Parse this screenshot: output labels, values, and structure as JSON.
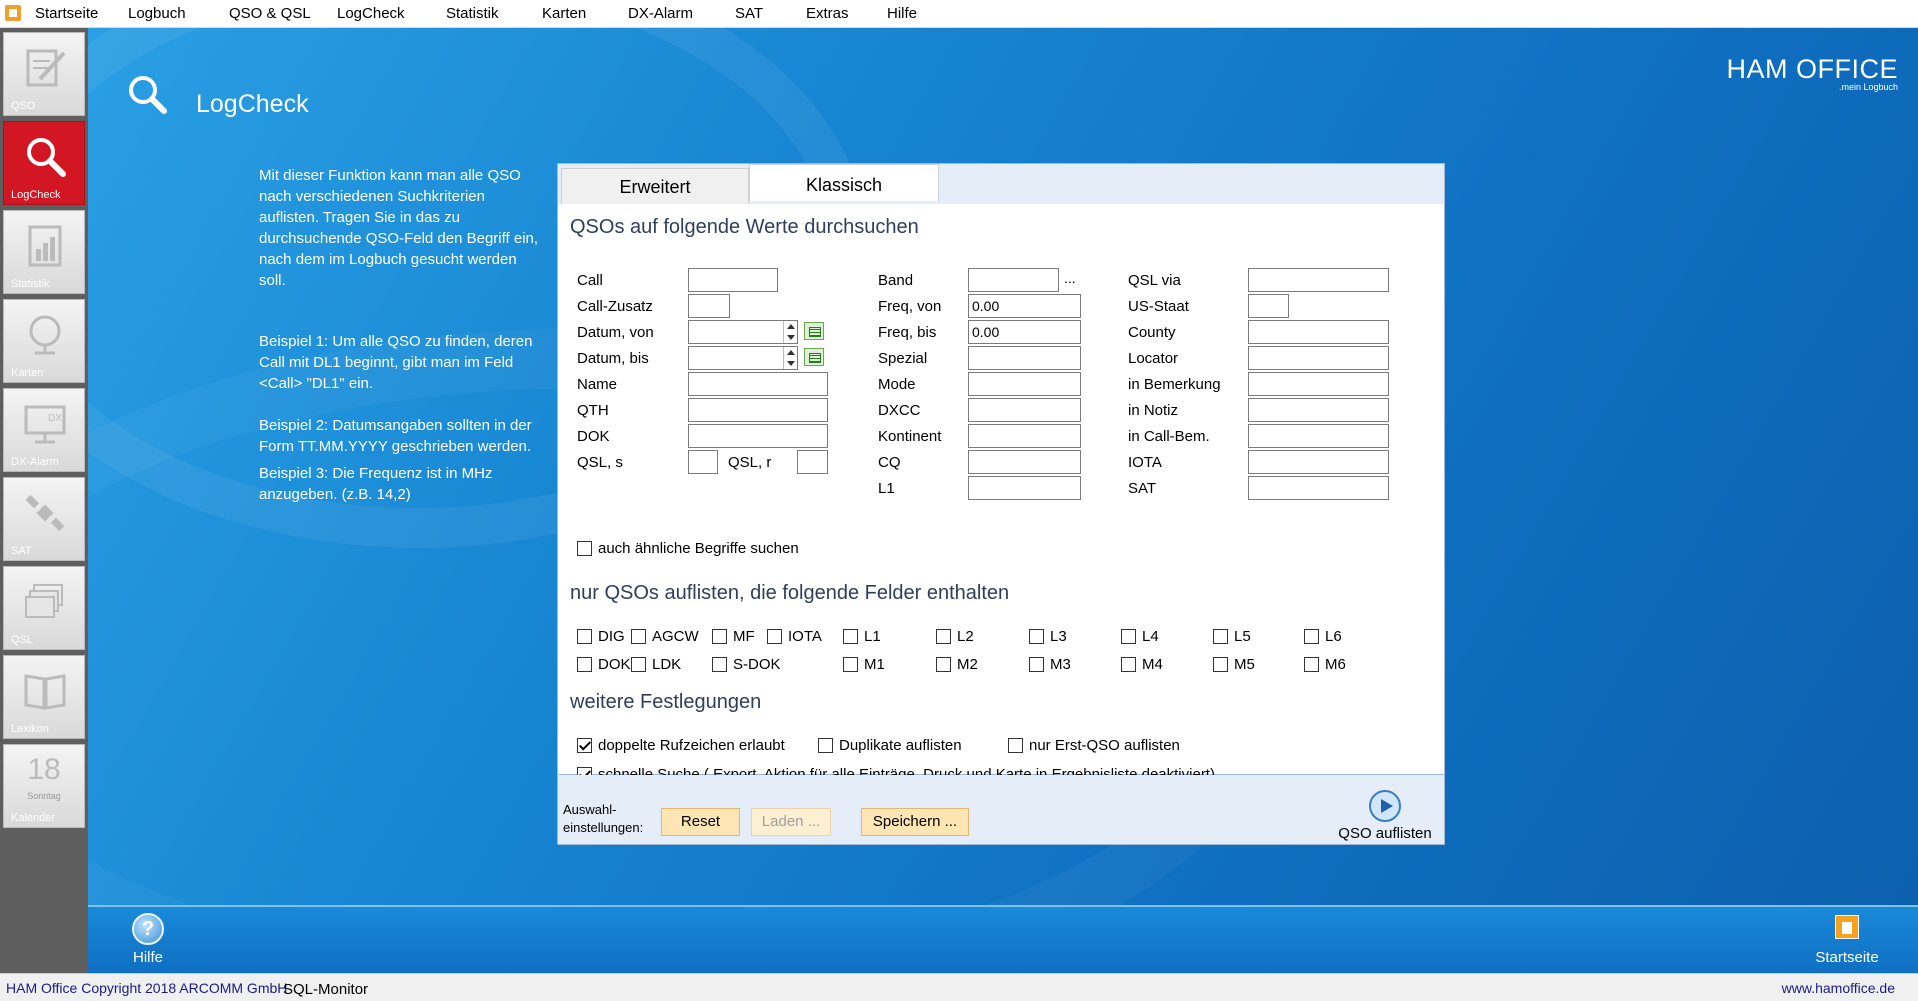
{
  "menu": [
    "Startseite",
    "Logbuch",
    "QSO & QSL",
    "LogCheck",
    "Statistik",
    "Karten",
    "DX-Alarm",
    "SAT",
    "Extras",
    "Hilfe"
  ],
  "nav": {
    "qso": "QSO",
    "logcheck": "LogCheck",
    "statistik": "Statistik",
    "karten": "Karten",
    "dxalarm": "DX-Alarm",
    "sat": "SAT",
    "qsl": "QSL",
    "lexikon": "Lexikon",
    "kalender": "Kalender",
    "calendar_day": "18",
    "calendar_weekday": "Sonntag",
    "dx_icon_text": "DX"
  },
  "page": {
    "title": "LogCheck"
  },
  "brand": {
    "name": "HAM OFFICE",
    "tagline": ".mein Logbuch"
  },
  "help": {
    "intro": "Mit dieser Funktion kann man alle QSO nach verschiedenen Suchkriterien auflisten. Tragen Sie in das zu durchsuchende QSO-Feld den Begriff ein, nach dem im Logbuch gesucht werden soll.",
    "ex1": "Beispiel 1: Um alle QSO zu finden, deren Call mit DL1 beginnt, gibt man im Feld <Call> \"DL1\" ein.",
    "ex2": "Beispiel 2: Datumsangaben sollten in der Form TT.MM.YYYY geschrieben werden.",
    "ex3": "Beispiel 3: Die Frequenz ist in MHz anzugeben. (z.B. 14,2)"
  },
  "tabs": {
    "erweitert": "Erweitert",
    "klassisch": "Klassisch"
  },
  "section1": "QSOs auf folgende Werte durchsuchen",
  "section2": "nur QSOs auflisten, die folgende Felder enthalten",
  "section3": "weitere Festlegungen",
  "fields": {
    "call": "Call",
    "call_zusatz": "Call-Zusatz",
    "datum_von": "Datum, von",
    "datum_bis": "Datum, bis",
    "name": "Name",
    "qth": "QTH",
    "dok": "DOK",
    "qsl_s": "QSL, s",
    "qsl_r": "QSL, r",
    "band": "Band",
    "band_more": "...",
    "freq_von": "Freq, von",
    "freq_von_value": "0.00",
    "freq_bis": "Freq, bis",
    "freq_bis_value": "0.00",
    "spezial": "Spezial",
    "mode": "Mode",
    "dxcc": "DXCC",
    "kontinent": "Kontinent",
    "cq": "CQ",
    "l1": "L1",
    "qsl_via": "QSL via",
    "us_staat": "US-Staat",
    "county": "County",
    "locator": "Locator",
    "in_bemerkung": "in Bemerkung",
    "in_notiz": "in Notiz",
    "in_call_bem": "in Call-Bem.",
    "iota": "IOTA",
    "sat": "SAT"
  },
  "similar": "auch ähnliche Begriffe suchen",
  "field_checks": {
    "dig": "DIG",
    "agcw": "AGCW",
    "mf": "MF",
    "iota": "IOTA",
    "l1": "L1",
    "l2": "L2",
    "l3": "L3",
    "l4": "L4",
    "l5": "L5",
    "l6": "L6",
    "dok": "DOK",
    "ldk": "LDK",
    "sdok": "S-DOK",
    "m1": "M1",
    "m2": "M2",
    "m3": "M3",
    "m4": "M4",
    "m5": "M5",
    "m6": "M6"
  },
  "options": {
    "doppelte": "doppelte Rufzeichen erlaubt",
    "duplikate": "Duplikate auflisten",
    "erst_qso": "nur Erst-QSO auflisten",
    "schnelle": "schnelle Suche ( Export, Aktion für alle Einträge, Druck und Karte in Ergebnisliste deaktiviert)"
  },
  "footer": {
    "auswahl1": "Auswahl-",
    "auswahl2": "einstellungen:",
    "reset": "Reset",
    "laden": "Laden ...",
    "speichern": "Speichern ...",
    "qso_auflisten": "QSO auflisten"
  },
  "bottom": {
    "hilfe": "Hilfe",
    "hilfe_glyph": "?",
    "startseite": "Startseite"
  },
  "status": {
    "copyright": "HAM Office Copyright 2018 ARCOMM GmbH",
    "sql": "SQL-Monitor",
    "url": "www.hamoffice.de"
  },
  "colors": {
    "accent_red": "#d31623",
    "main_blue": "#1785d2",
    "button_bg": "#fde6b4"
  }
}
